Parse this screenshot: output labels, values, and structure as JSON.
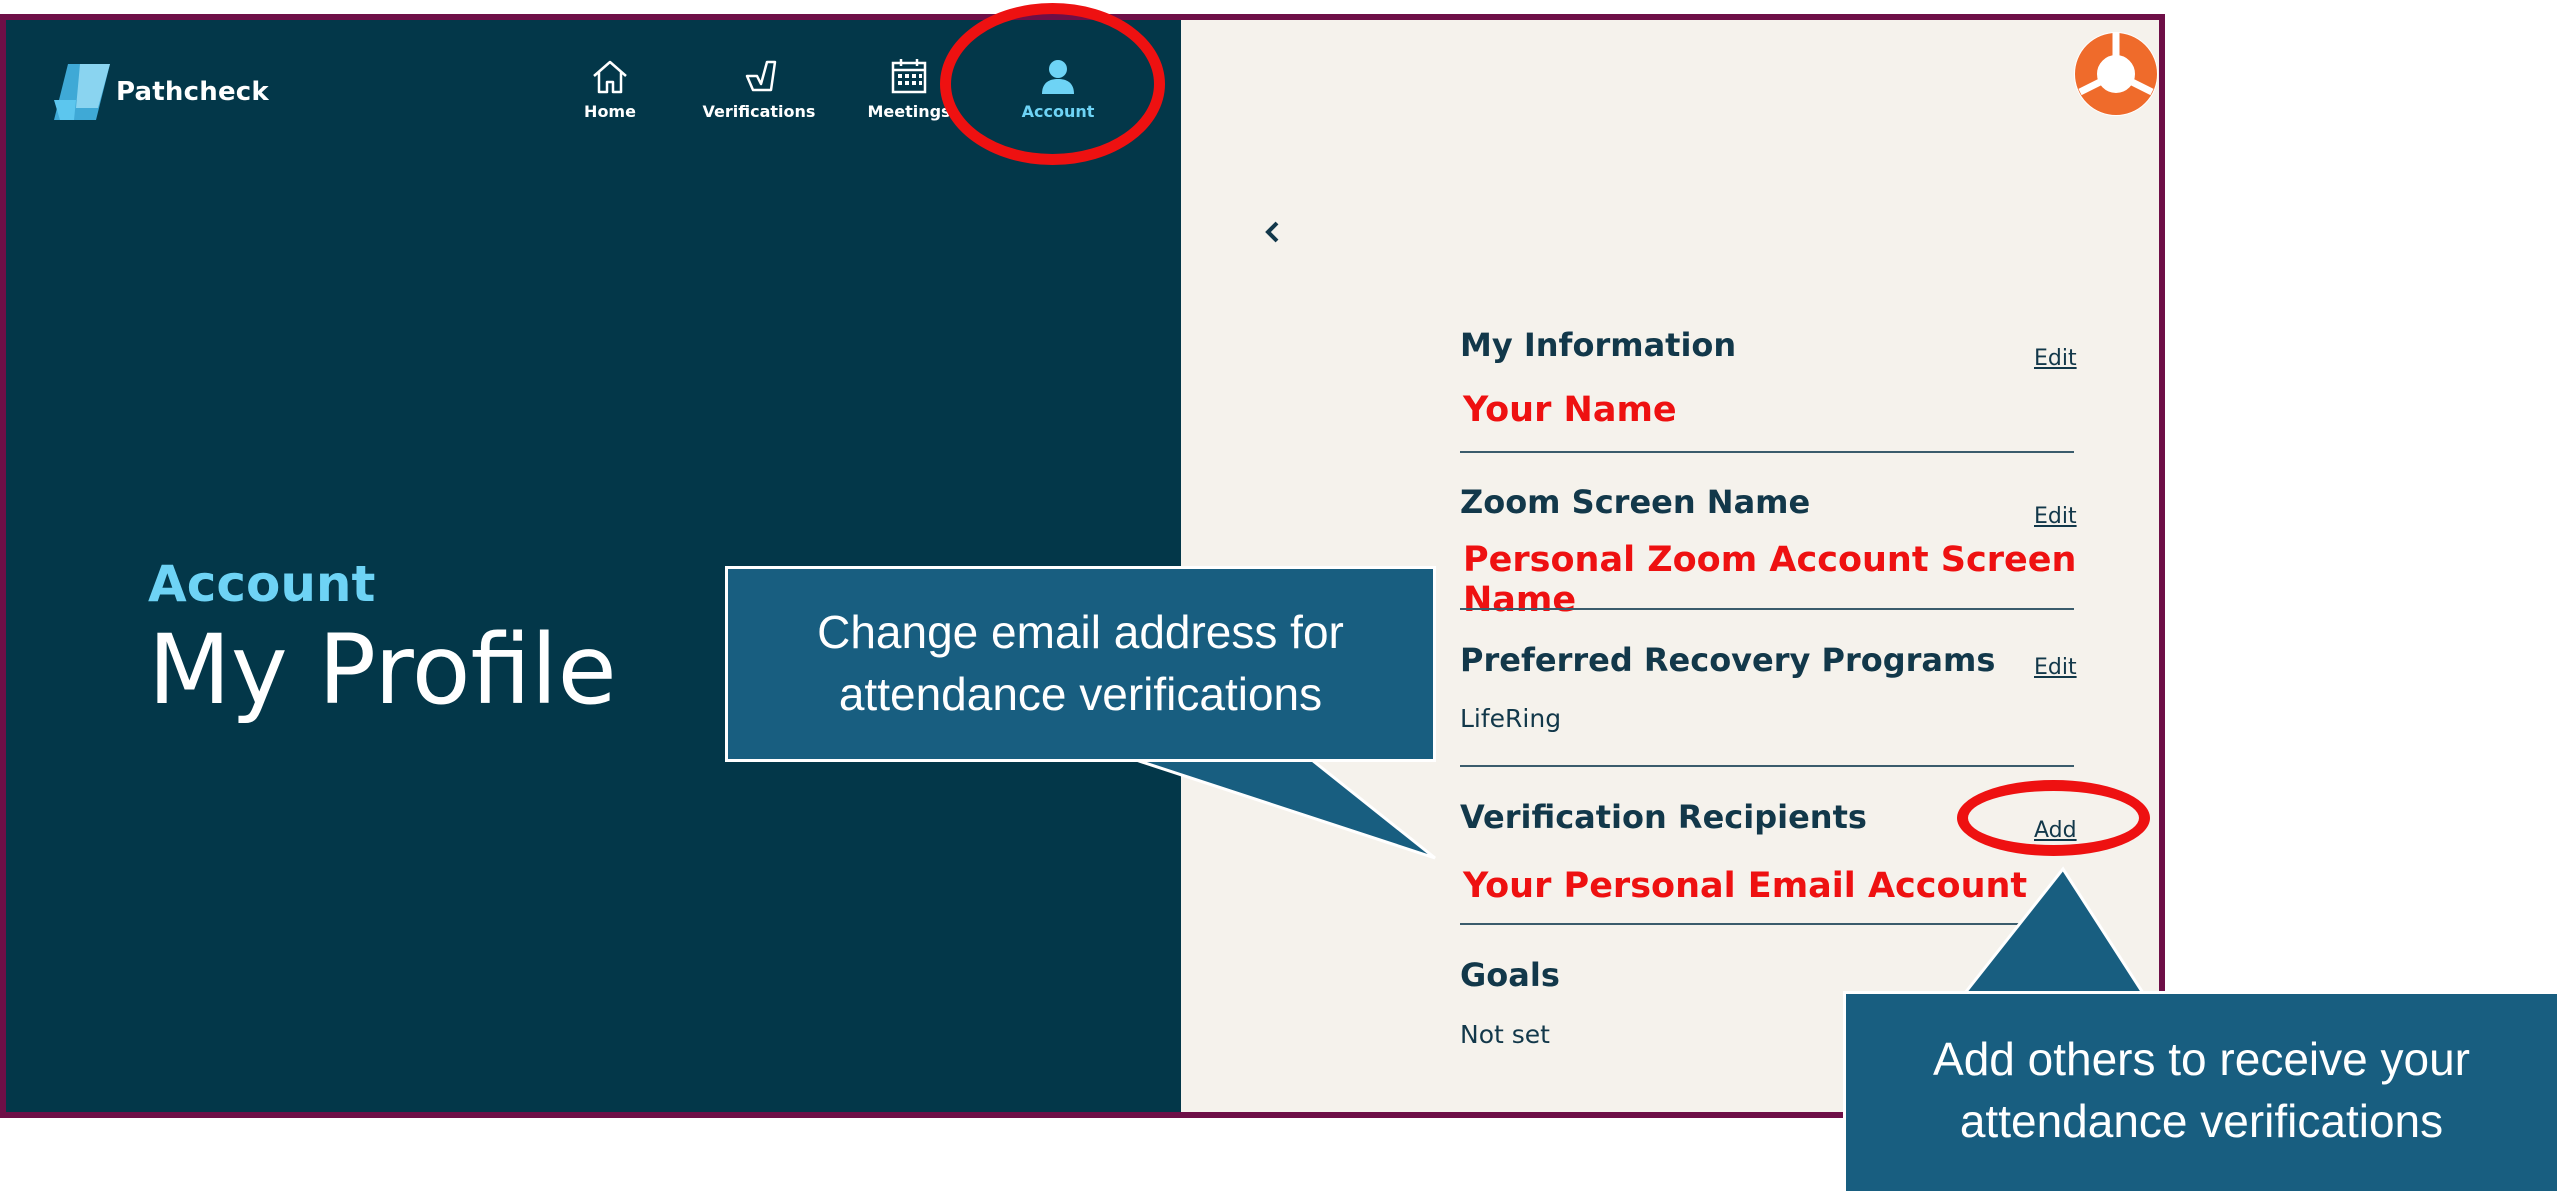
{
  "app": {
    "name": "Pathcheck"
  },
  "nav": {
    "items": [
      {
        "label": "Home",
        "icon": "home-icon"
      },
      {
        "label": "Verifications",
        "icon": "verifications-icon"
      },
      {
        "label": "Meetings",
        "icon": "calendar-icon"
      },
      {
        "label": "Account",
        "icon": "person-icon"
      }
    ],
    "active_index": 3
  },
  "hero": {
    "kicker": "Account",
    "title": "My Profile"
  },
  "sections": [
    {
      "title": "My Information",
      "action": "Edit",
      "value": ""
    },
    {
      "title": "Zoom Screen Name",
      "action": "Edit",
      "value": ""
    },
    {
      "title": "Preferred Recovery Programs",
      "action": "Edit",
      "value": "LifeRing"
    },
    {
      "title": "Verification Recipients",
      "action": "Add",
      "value": ""
    },
    {
      "title": "Goals",
      "action": "",
      "value": "Not set"
    }
  ],
  "annotations": {
    "your_name": "Your Name",
    "zoom_name": "Personal Zoom Account Screen Name",
    "email": "Your Personal Email Account",
    "callout_left": [
      "Change email address for",
      "attendance verifications"
    ],
    "callout_right": [
      "Add others to receive your",
      "attendance verifications"
    ]
  },
  "colors": {
    "left_panel": "#033749",
    "right_panel": "#f5f2ec",
    "accent": "#6ed3f5",
    "annotation_red": "#ee1111",
    "callout_blue": "#185e80",
    "frame": "#6e0f47",
    "lifebuoy": "#ef6b2b"
  }
}
